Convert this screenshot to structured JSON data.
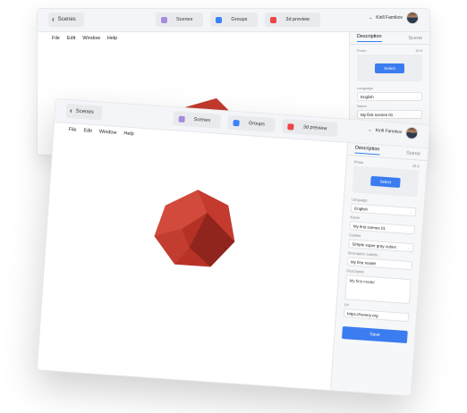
{
  "header": {
    "back_label": "Scenes",
    "tabs": [
      {
        "label": "Scenes",
        "icon": "scenes-icon"
      },
      {
        "label": "Groups",
        "icon": "groups-icon"
      },
      {
        "label": "3d preview",
        "icon": "3d-preview-icon"
      }
    ],
    "user_name": "Kirill Famikov"
  },
  "menu": [
    "File",
    "Edit",
    "Window",
    "Help"
  ],
  "panel": {
    "tabs": [
      "Description",
      "Scene"
    ],
    "photo_label": "Photo",
    "photo_ratio": "16:9",
    "select_label": "Select",
    "language_label": "Language",
    "language_value": "English",
    "name_label": "Name",
    "name_value": "My first scenes 01",
    "subtitle_label": "Subtitle",
    "subtitle_value": "Simple super gray cubes",
    "desc_subtitle_label": "Description subtitle",
    "desc_subtitle_value": "My first model",
    "description_label": "Description",
    "description_value": "My first model",
    "url_label": "Url",
    "url_value": "https://hooery.org",
    "save_label": "Save"
  },
  "colors": {
    "accent": "#3b7cf0",
    "model": "#c0392b"
  }
}
